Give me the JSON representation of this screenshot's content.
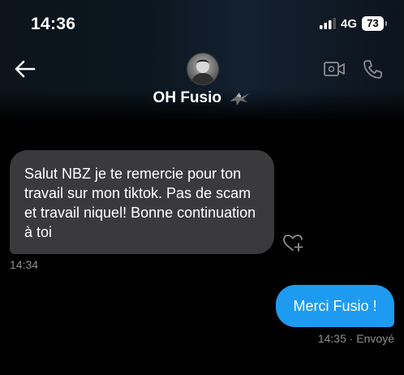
{
  "status_bar": {
    "time": "14:36",
    "network": "4G",
    "battery": "73"
  },
  "header": {
    "contact_name": "OH Fusio",
    "icons": [
      "back-arrow-icon",
      "avatar",
      "bird-emoji-icon",
      "video-camera-icon",
      "phone-icon"
    ]
  },
  "messages": [
    {
      "direction": "incoming",
      "text": "Salut NBZ je te remercie pour ton travail sur mon tiktok. Pas de scam et travail niquel! Bonne continuation à toi",
      "time": "14:34"
    },
    {
      "direction": "outgoing",
      "text": "Merci Fusio !",
      "time": "14:35",
      "status": "Envoyé",
      "meta": "14:35 · Envoyé"
    }
  ],
  "colors": {
    "incoming_bubble": "#3a3a3c",
    "outgoing_bubble": "#1d9bf0",
    "timestamp": "#8e8e93"
  }
}
